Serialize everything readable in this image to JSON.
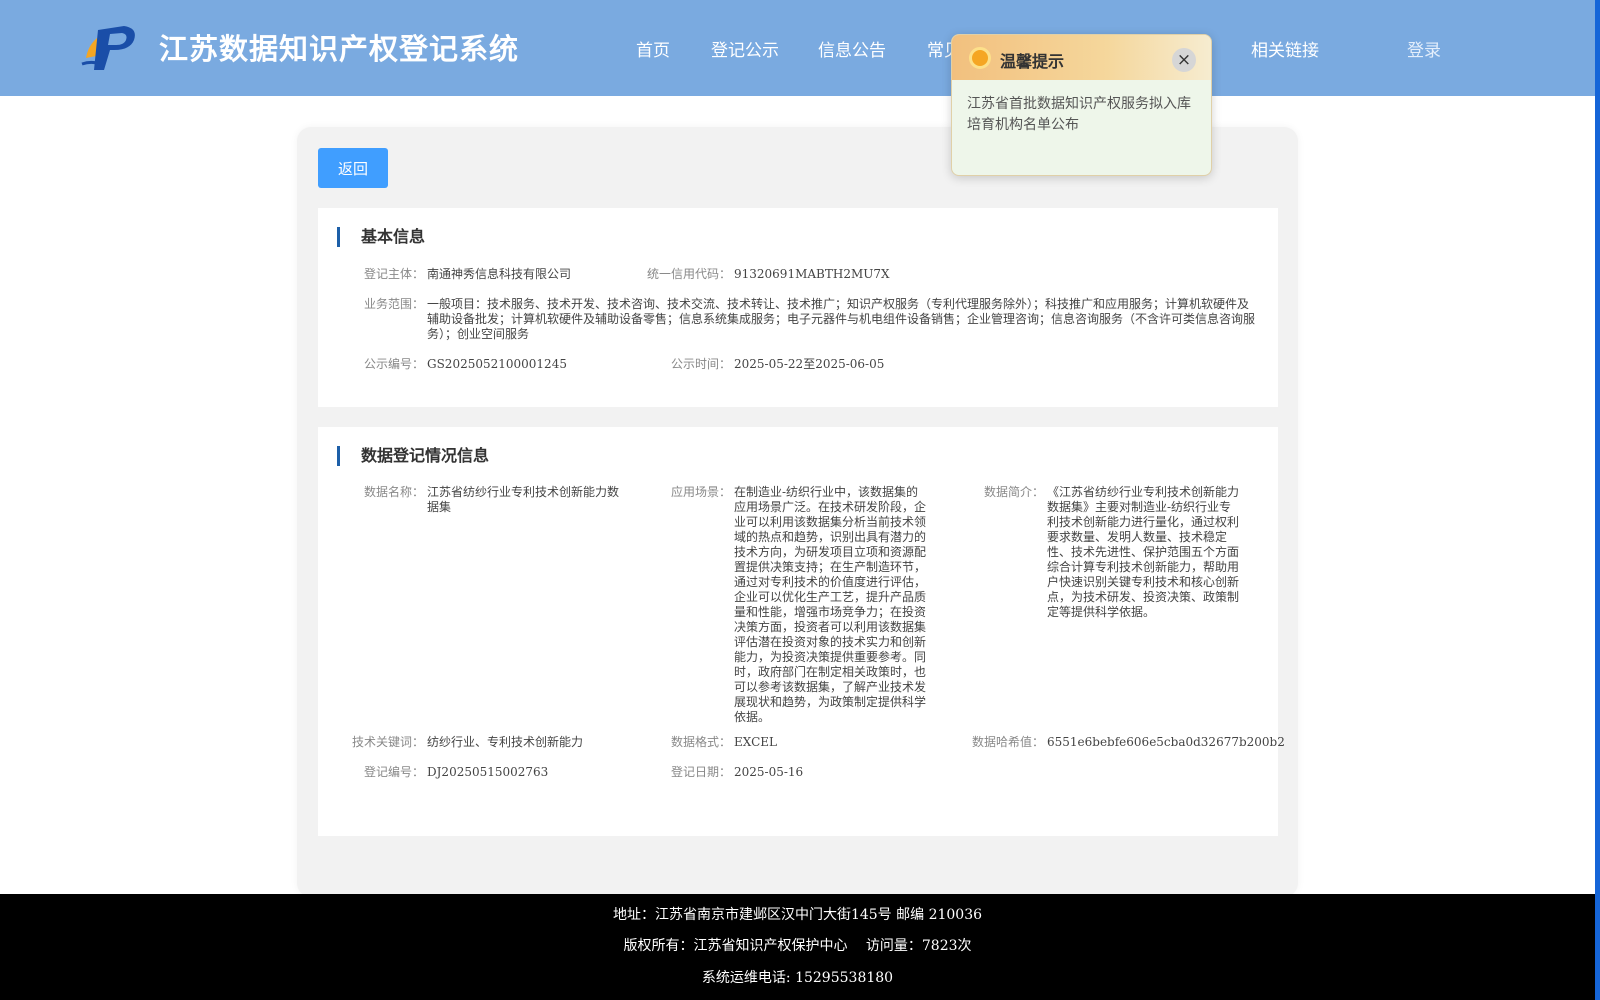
{
  "header": {
    "site_title": "江苏数据知识产权登记系统",
    "nav": [
      "首页",
      "登记公示",
      "信息公告",
      "常见问题",
      "相关链接"
    ],
    "login_label": "登录"
  },
  "back_label": "返回",
  "basic": {
    "title": "基本信息",
    "subject_label": "登记主体：",
    "subject": "南通神秀信息科技有限公司",
    "credit_label": "统一信用代码：",
    "credit": "91320691MABTH2MU7X",
    "scope_label": "业务范围：",
    "scope": "一般项目：技术服务、技术开发、技术咨询、技术交流、技术转让、技术推广；知识产权服务（专利代理服务除外）；科技推广和应用服务；计算机软硬件及辅助设备批发；计算机软硬件及辅助设备零售；信息系统集成服务；电子元器件与机电组件设备销售；企业管理咨询；信息咨询服务（不含许可类信息咨询服务）；创业空间服务",
    "pub_no_label": "公示编号：",
    "pub_no": "GS2025052100001245",
    "pub_time_label": "公示时间：",
    "pub_time": "2025-05-22至2025-06-05"
  },
  "data_info": {
    "title": "数据登记情况信息",
    "name_label": "数据名称：",
    "name": "江苏省纺纱行业专利技术创新能力数据集",
    "scene_label": "应用场景：",
    "scene": "在制造业-纺织行业中，该数据集的应用场景广泛。在技术研发阶段，企业可以利用该数据集分析当前技术领域的热点和趋势，识别出具有潜力的技术方向，为研发项目立项和资源配置提供决策支持；在生产制造环节，通过对专利技术的价值度进行评估，企业可以优化生产工艺，提升产品质量和性能，增强市场竞争力；在投资决策方面，投资者可以利用该数据集评估潜在投资对象的技术实力和创新能力，为投资决策提供重要参考。同时，政府部门在制定相关政策时，也可以参考该数据集，了解产业技术发展现状和趋势，为政策制定提供科学依据。",
    "intro_label": "数据简介：",
    "intro": "《江苏省纺纱行业专利技术创新能力数据集》主要对制造业-纺织行业专利技术创新能力进行量化，通过权利要求数量、发明人数量、技术稳定性、技术先进性、保护范围五个方面综合计算专利技术创新能力，帮助用户快速识别关键专利技术和核心创新点，为技术研发、投资决策、政策制定等提供科学依据。",
    "keyword_label": "技术关键词：",
    "keyword": "纺纱行业、专利技术创新能力",
    "format_label": "数据格式：",
    "format": "EXCEL",
    "hash_label": "数据哈希值：",
    "hash": "6551e6bebfe606e5cba0d32677b200b2",
    "reg_no_label": "登记编号：",
    "reg_no": "DJ20250515002763",
    "reg_date_label": "登记日期：",
    "reg_date": "2025-05-16"
  },
  "popup": {
    "title": "温馨提示",
    "close": "×",
    "text": "江苏省首批数据知识产权服务拟入库培育机构名单公布"
  },
  "footer": {
    "address": "地址：江苏省南京市建邺区汉中门大街145号 邮编 210036",
    "copyright": "版权所有：江苏省知识产权保护中心　 访问量：7823次",
    "phone": "系统运维电话: 15295538180"
  },
  "colors": {
    "header_bg": "#7aaae0",
    "button_bg": "#409eff",
    "section_accent": "#1d5fa8",
    "footer_bg": "#000000"
  }
}
